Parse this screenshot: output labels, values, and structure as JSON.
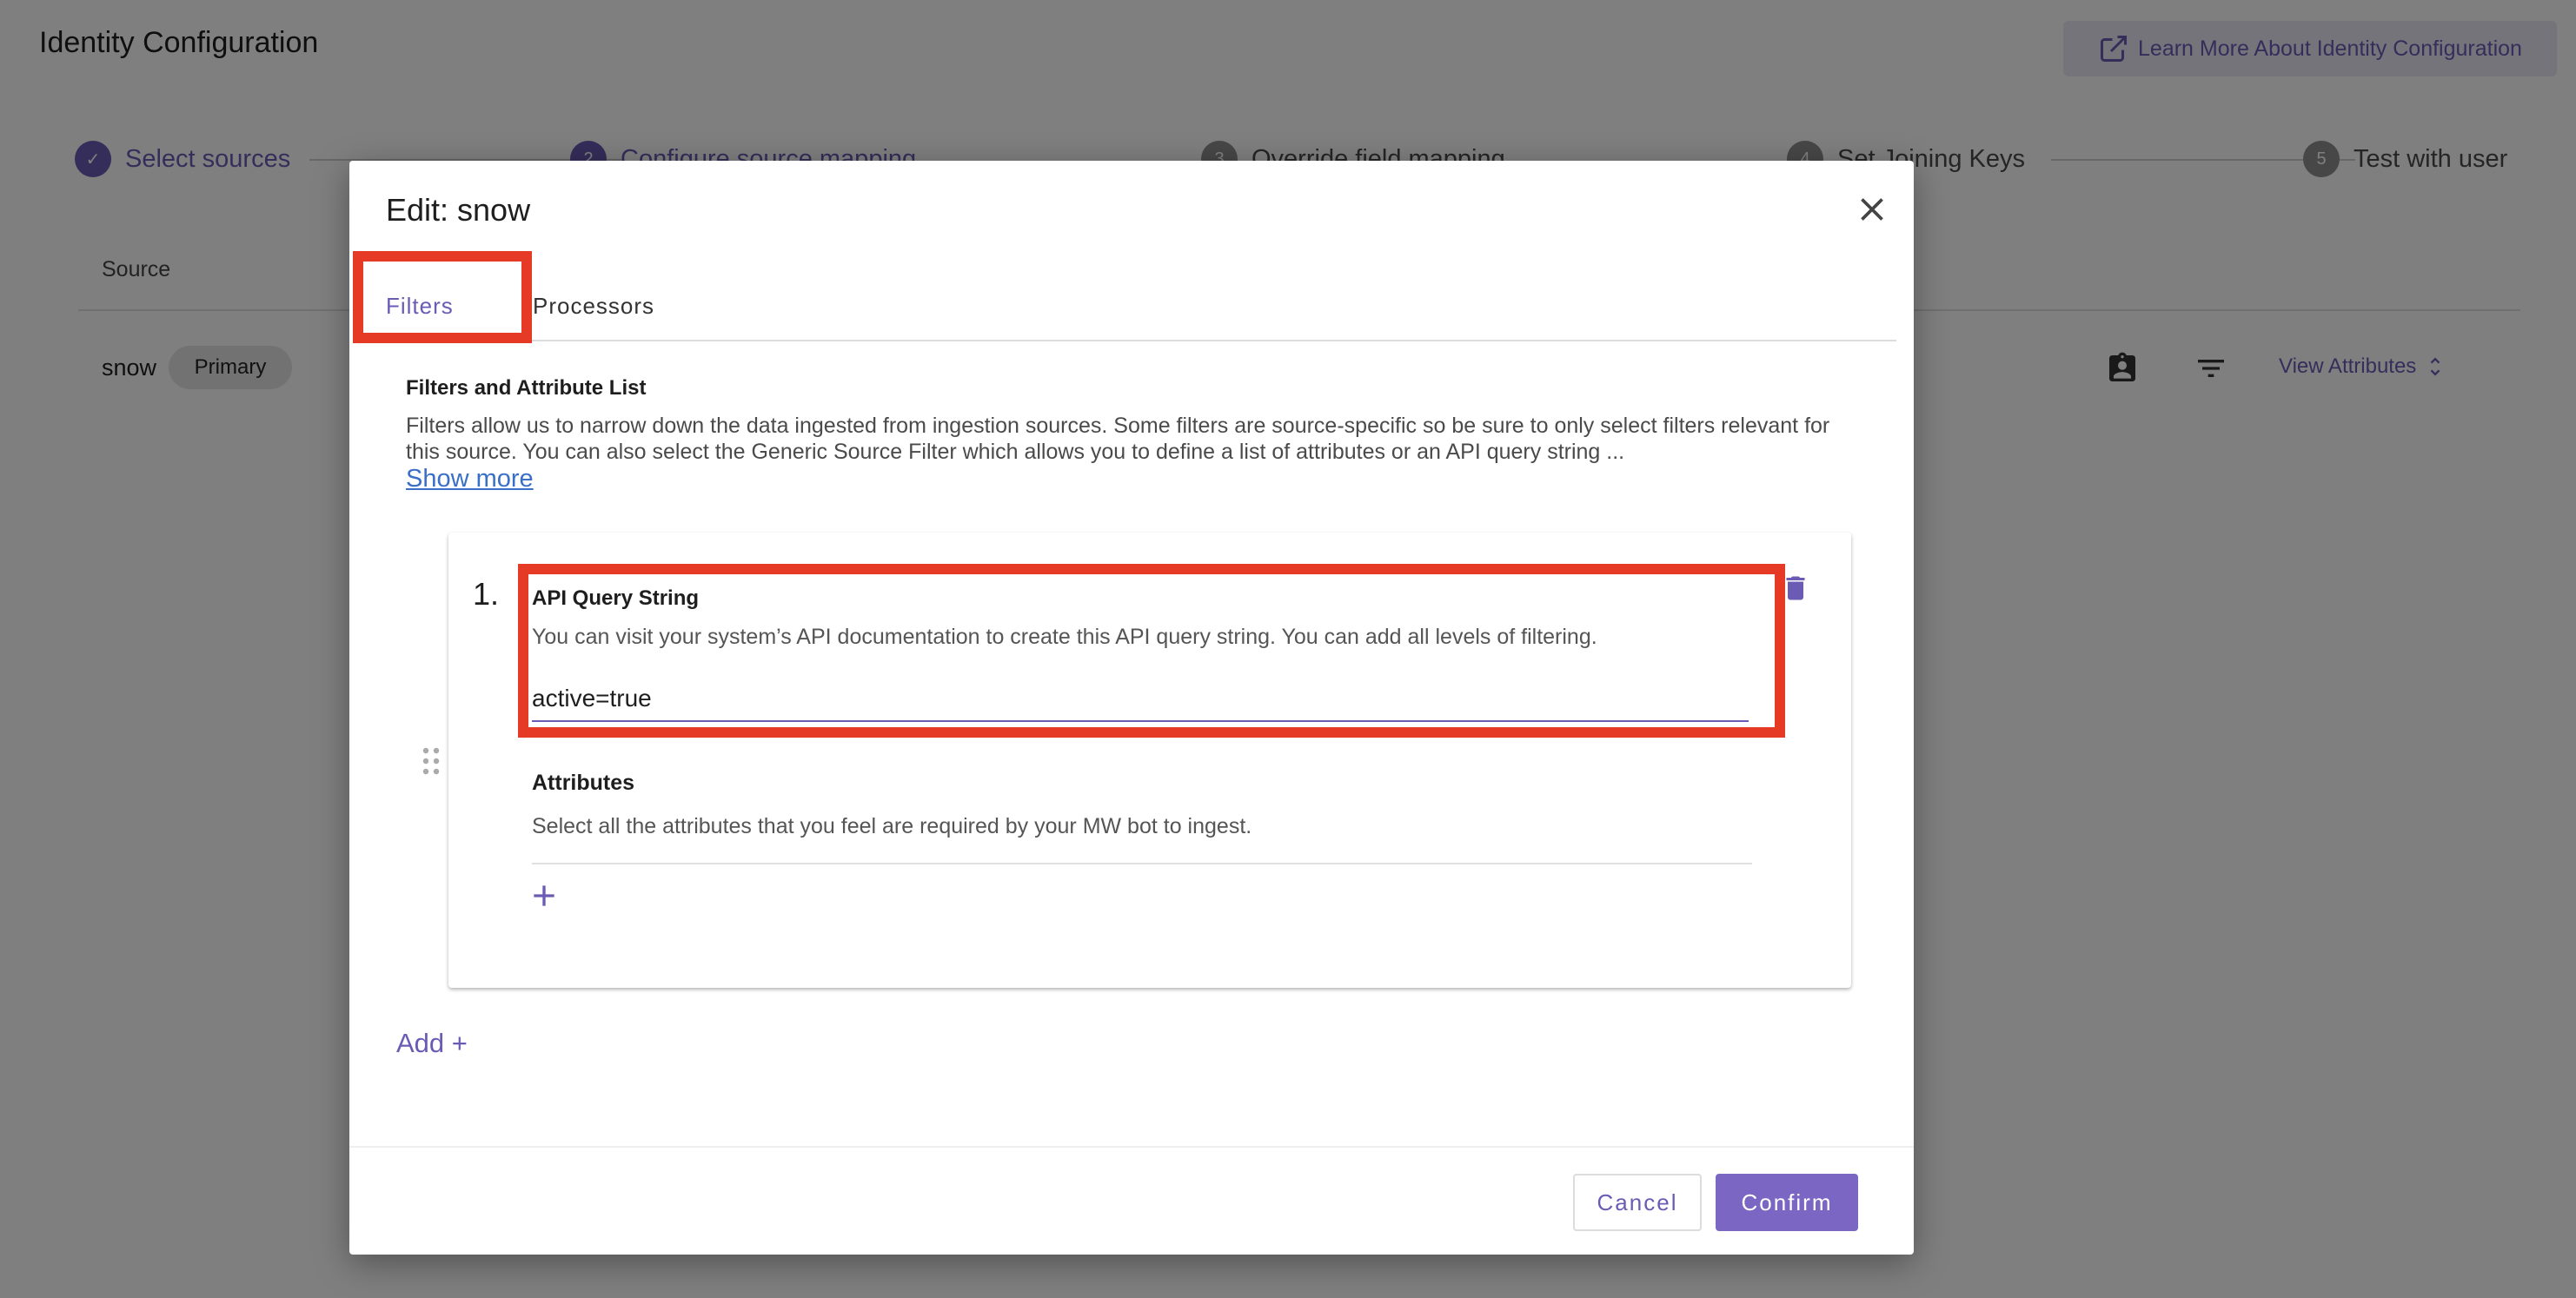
{
  "page": {
    "title": "Identity Configuration",
    "learn_more_label": "Learn More About Identity Configuration",
    "steps": [
      {
        "number": "1",
        "label": "Select sources",
        "state": "done"
      },
      {
        "number": "2",
        "label": "Configure source mapping",
        "state": "active"
      },
      {
        "number": "3",
        "label": "Override field mapping",
        "state": "pending"
      },
      {
        "number": "4",
        "label": "Set Joining Keys",
        "state": "pending"
      },
      {
        "number": "5",
        "label": "Test with user",
        "state": "pending"
      }
    ],
    "table": {
      "source_header": "Source",
      "row": {
        "name": "snow",
        "badge": "Primary",
        "view_attributes_label": "View Attributes"
      }
    }
  },
  "modal": {
    "title": "Edit: snow",
    "tabs": [
      {
        "label": "Filters",
        "selected": true
      },
      {
        "label": "Processors",
        "selected": false
      }
    ],
    "section_title": "Filters and Attribute List",
    "section_description": "Filters allow us to narrow down the data ingested from ingestion sources. Some filters are source-specific so be sure to only select filters relevant for this source. You can also select the Generic Source Filter which allows you to define a list of attributes or an API query string ...",
    "show_more_label": "Show more",
    "filter_item": {
      "number": "1.",
      "api_title": "API Query String",
      "api_description": "You can visit your system’s API documentation to create this API query string. You can add all levels of filtering.",
      "api_value": "active=true",
      "attributes_title": "Attributes",
      "attributes_description": "Select all the attributes that you feel are required by your MW bot to ingest."
    },
    "add_label": "Add +",
    "cancel_label": "Cancel",
    "confirm_label": "Confirm"
  },
  "colors": {
    "accent": "#6b5bb5",
    "highlight": "#e53b26",
    "link": "#3a6fc8"
  },
  "icons": [
    "external-link-icon",
    "check-icon",
    "contact-card-icon",
    "filter-icon",
    "unfold-icon",
    "close-icon",
    "drag-handle-icon",
    "trash-icon",
    "plus-icon"
  ]
}
